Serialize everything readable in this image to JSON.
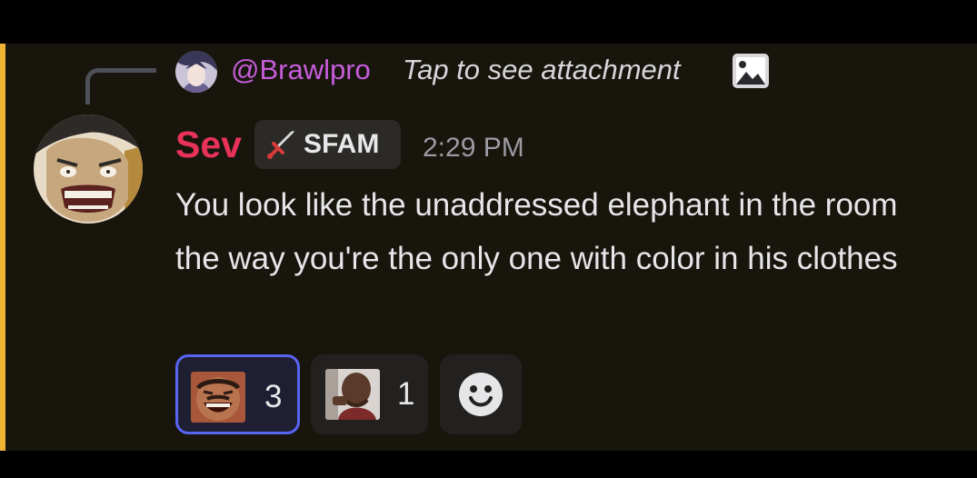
{
  "reply": {
    "author": "@Brawlpro",
    "preview": "Tap to see attachment",
    "avatar_icon": "anime-avatar",
    "attachment_icon": "image-icon"
  },
  "message": {
    "author": "Sev",
    "author_color": "#e8325a",
    "avatar_icon": "manga-face-avatar",
    "role_tag": {
      "icon": "sword-icon",
      "label": "SFAM"
    },
    "timestamp": "2:29 PM",
    "content": "You look like the unaddressed elephant in the room the way you're the only one with color in his clothes",
    "highlight_color": "#f0b232"
  },
  "reactions": [
    {
      "emoji": "laughing-man-emoji",
      "count": "3",
      "active": true
    },
    {
      "emoji": "sad-man-emoji",
      "count": "1",
      "active": false
    }
  ],
  "add_reaction": {
    "icon": "smiley-add-reaction-icon"
  },
  "colors": {
    "accent": "#5865f2",
    "background": "#18150d"
  }
}
